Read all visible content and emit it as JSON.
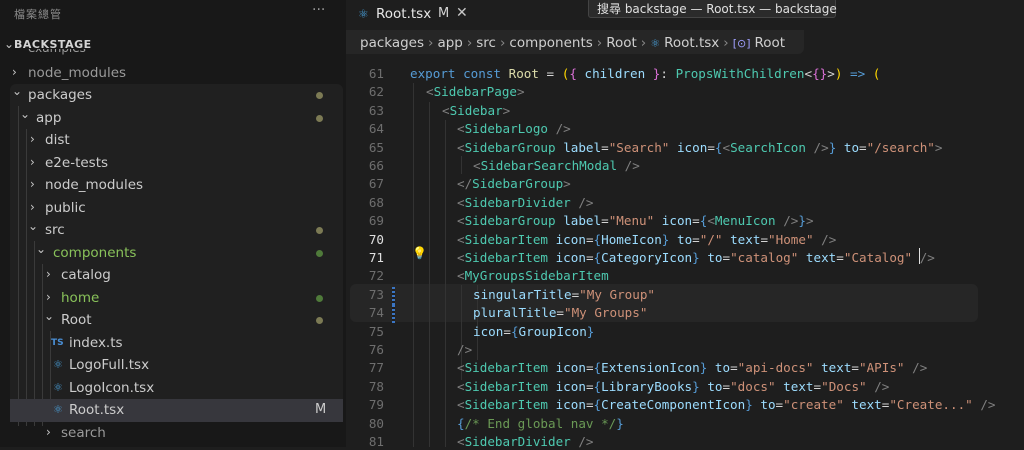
{
  "sidebar": {
    "title": "檔案總管",
    "more_label": "···",
    "section_label": "BACKSTAGE",
    "cutoff_text": "examples",
    "items": [
      {
        "label": "node_modules",
        "chevron": "›"
      },
      {
        "label": "packages",
        "chevron": "⌄"
      },
      {
        "label": "app",
        "chevron": "⌄"
      },
      {
        "label": "dist",
        "chevron": "›"
      },
      {
        "label": "e2e-tests",
        "chevron": "›"
      },
      {
        "label": "node_modules",
        "chevron": "›"
      },
      {
        "label": "public",
        "chevron": "›"
      },
      {
        "label": "src",
        "chevron": "⌄"
      },
      {
        "label": "components",
        "chevron": "⌄"
      },
      {
        "label": "catalog",
        "chevron": "›"
      },
      {
        "label": "home",
        "chevron": "›"
      },
      {
        "label": "Root",
        "chevron": "⌄"
      },
      {
        "label": "index.ts",
        "icon": "TS"
      },
      {
        "label": "LogoFull.tsx",
        "icon": "⚛"
      },
      {
        "label": "LogoIcon.tsx",
        "icon": "⚛"
      },
      {
        "label": "Root.tsx",
        "icon": "⚛",
        "badge": "M"
      },
      {
        "label": "search",
        "chevron": "›"
      }
    ]
  },
  "editor": {
    "tab": {
      "icon": "⚛",
      "name": "Root.tsx",
      "status": "M",
      "close": "✕"
    },
    "tooltip": "搜尋 backstage — Root.tsx — backstage",
    "breadcrumb": {
      "parts": [
        "packages",
        "app",
        "src",
        "components",
        "Root"
      ],
      "file_icon": "⚛",
      "file": "Root.tsx",
      "symbol_icon": "[⊙]",
      "symbol": "Root"
    },
    "line_numbers": [
      "61",
      "62",
      "63",
      "64",
      "65",
      "66",
      "67",
      "68",
      "69",
      "70",
      "71",
      "72",
      "73",
      "74",
      "75",
      "76",
      "77",
      "78",
      "79",
      "80",
      "81"
    ],
    "lines": {
      "l61": [
        "export",
        "const",
        "Root",
        "=",
        "(",
        "{",
        "children",
        "}",
        ":",
        "PropsWithChildren",
        "<",
        "{}",
        ">",
        ")",
        "=>",
        "("
      ],
      "l62": [
        "<",
        "SidebarPage",
        ">"
      ],
      "l63": [
        "<",
        "Sidebar",
        ">"
      ],
      "l64": [
        "<",
        "SidebarLogo",
        "/>"
      ],
      "l65": [
        "<",
        "SidebarGroup",
        "label",
        "=",
        "\"Search\"",
        "icon",
        "=",
        "{",
        "<",
        "SearchIcon",
        "/>",
        "}",
        "to",
        "=",
        "\"/search\"",
        ">"
      ],
      "l66": [
        "<",
        "SidebarSearchModal",
        "/>"
      ],
      "l67": [
        "</",
        "SidebarGroup",
        ">"
      ],
      "l68": [
        "<",
        "SidebarDivider",
        "/>"
      ],
      "l69": [
        "<",
        "SidebarGroup",
        "label",
        "=",
        "\"Menu\"",
        "icon",
        "=",
        "{",
        "<",
        "MenuIcon",
        "/>",
        "}",
        ">"
      ],
      "l70": [
        "<",
        "SidebarItem",
        "icon",
        "=",
        "{",
        "HomeIcon",
        "}",
        "to",
        "=",
        "\"/\"",
        "text",
        "=",
        "\"Home\"",
        "/>"
      ],
      "l71": [
        "<",
        "SidebarItem",
        "icon",
        "=",
        "{",
        "CategoryIcon",
        "}",
        "to",
        "=",
        "\"catalog\"",
        "text",
        "=",
        "\"Catalog\"",
        "/>"
      ],
      "l72": [
        "<",
        "MyGroupsSidebarItem"
      ],
      "l73": [
        "singularTitle",
        "=",
        "\"My Group\""
      ],
      "l74": [
        "pluralTitle",
        "=",
        "\"My Groups\""
      ],
      "l75": [
        "icon",
        "=",
        "{",
        "GroupIcon",
        "}"
      ],
      "l76": [
        "/>"
      ],
      "l77": [
        "<",
        "SidebarItem",
        "icon",
        "=",
        "{",
        "ExtensionIcon",
        "}",
        "to",
        "=",
        "\"api-docs\"",
        "text",
        "=",
        "\"APIs\"",
        "/>"
      ],
      "l78": [
        "<",
        "SidebarItem",
        "icon",
        "=",
        "{",
        "LibraryBooks",
        "}",
        "to",
        "=",
        "\"docs\"",
        "text",
        "=",
        "\"Docs\"",
        "/>"
      ],
      "l79": [
        "<",
        "SidebarItem",
        "icon",
        "=",
        "{",
        "CreateComponentIcon",
        "}",
        "to",
        "=",
        "\"create\"",
        "text",
        "=",
        "\"Create...\"",
        "/>"
      ],
      "l80": [
        "{",
        "/* End global nav */",
        "}"
      ],
      "l81": [
        "<",
        "SidebarDivider",
        "/>"
      ]
    },
    "lightbulb_icon": "💡"
  },
  "colors": {
    "background": "#1e1e1e",
    "sidebar_bg": "#181818",
    "selection": "#37373d",
    "keyword": "#569cd6",
    "tag": "#4ec9b0",
    "attribute": "#9cdcfe",
    "string": "#ce9178",
    "modified_dot": "#7c7a54",
    "untracked_green": "#89c25a"
  }
}
